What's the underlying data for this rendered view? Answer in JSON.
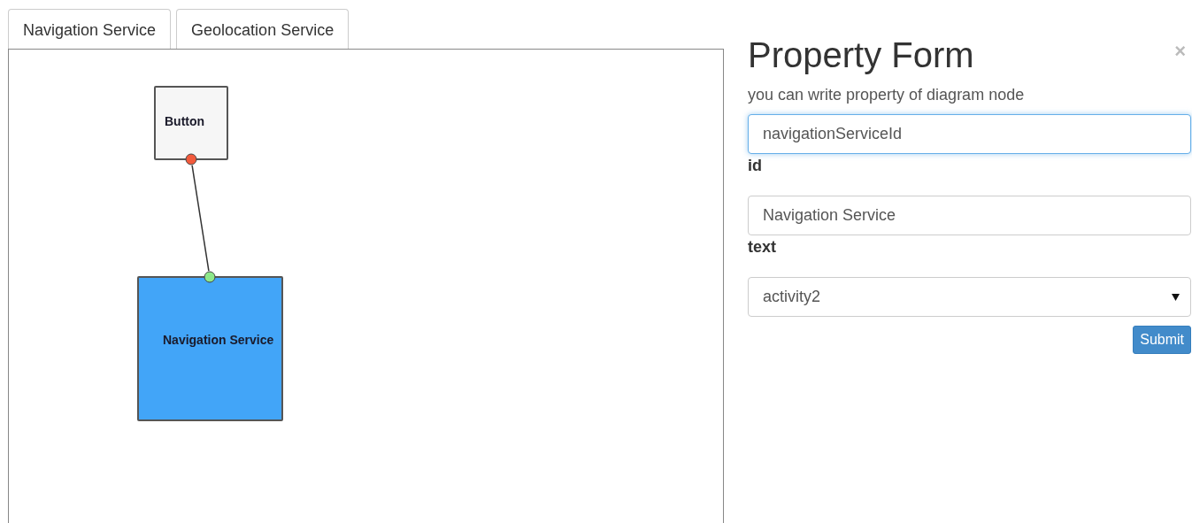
{
  "tabs": [
    {
      "label": "Navigation Service"
    },
    {
      "label": "Geolocation Service"
    }
  ],
  "diagram": {
    "nodes": [
      {
        "label": "Button",
        "color": "#f6f6f6"
      },
      {
        "label": "Navigation Service",
        "color": "#42a5f8"
      }
    ],
    "ports": [
      {
        "color": "#f25a3c"
      },
      {
        "color": "#8ee88a"
      }
    ]
  },
  "form": {
    "title": "Property Form",
    "subtitle": "you can write property of diagram node",
    "fields": [
      {
        "kind": "input",
        "value": "navigationServiceId",
        "focused": true,
        "label": "id"
      },
      {
        "kind": "input",
        "value": "Navigation Service",
        "focused": false,
        "label": "text"
      },
      {
        "kind": "select",
        "value": "activity2"
      }
    ],
    "close": "×",
    "submit": "Submit"
  }
}
